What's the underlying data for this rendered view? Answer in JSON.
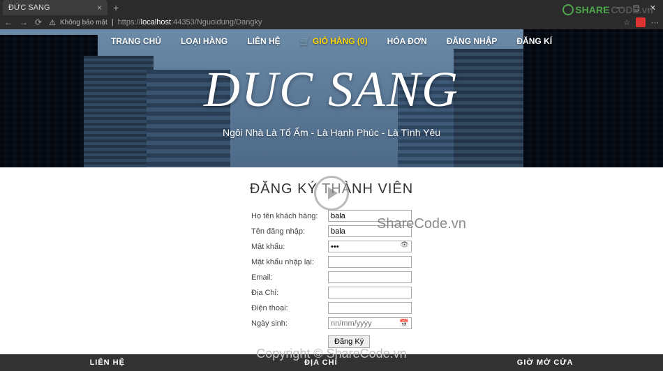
{
  "browser": {
    "tab_title": "ĐỨC SANG",
    "security_text": "Không bảo mật",
    "url_prefix": "https://",
    "url_host": "localhost",
    "url_path": ":44353/Nguoidung/Dangky"
  },
  "nav": {
    "home": "TRANG CHỦ",
    "category": "LOẠI HÀNG",
    "contact": "LIÊN HỆ",
    "cart_icon": "🛒",
    "cart": "GIỎ HÀNG (0)",
    "invoice": "HÓA ĐƠN",
    "login": "ĐĂNG NHẬP",
    "register": "ĐĂNG KÍ"
  },
  "hero": {
    "logo": "DUC SANG",
    "tagline": "Ngôi Nhà Là Tổ Ấm - Là Hạnh Phúc - Là Tình Yêu"
  },
  "page": {
    "title": "ĐĂNG KÝ THÀNH VIÊN"
  },
  "form": {
    "fullname_label": "Họ tên khách hàng:",
    "fullname_value": "bala",
    "username_label": "Tên đăng nhập:",
    "username_value": "bala",
    "password_label": "Mật khẩu:",
    "password_value": "•••",
    "password2_label": "Mật khẩu nhập lại:",
    "password2_value": "",
    "email_label": "Email:",
    "email_value": "",
    "address_label": "Địa Chỉ:",
    "address_value": "",
    "phone_label": "Điện thoại:",
    "phone_value": "",
    "dob_label": "Ngày sinh:",
    "dob_placeholder": "nn/mm/yyyy",
    "submit": "Đăng Ký"
  },
  "footer": {
    "col1": "LIÊN HỆ",
    "col2": "ĐỊA CHỈ",
    "col3": "GIỜ MỞ CỬA"
  },
  "watermark": {
    "logo_green": "SHARE",
    "logo_gray": "CODE.vn",
    "center": "ShareCode.vn",
    "bottom": "Copyright © ShareCode.vn"
  }
}
